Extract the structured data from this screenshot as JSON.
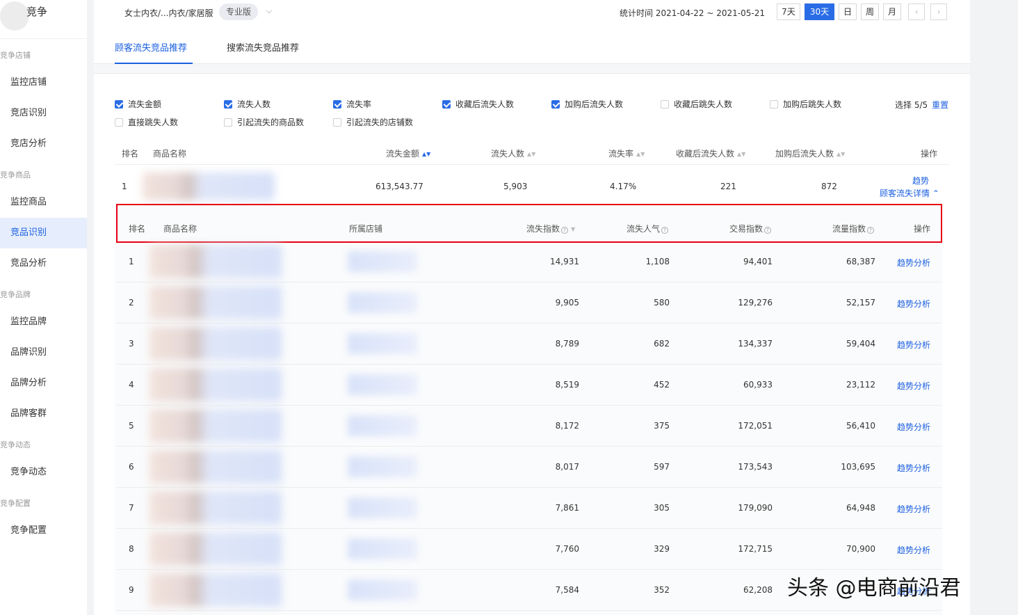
{
  "sidebar": {
    "brand": "竞争",
    "groups": [
      {
        "title": "竞争店铺",
        "items": [
          "监控店铺",
          "竞店识别",
          "竞店分析"
        ]
      },
      {
        "title": "竞争商品",
        "items": [
          "监控商品",
          "竞品识别",
          "竞品分析"
        ]
      },
      {
        "title": "竞争品牌",
        "items": [
          "监控品牌",
          "品牌识别",
          "品牌分析",
          "品牌客群"
        ]
      },
      {
        "title": "竞争动态",
        "items": [
          "竞争动态"
        ]
      },
      {
        "title": "竞争配置",
        "items": [
          "竞争配置"
        ]
      }
    ],
    "active_item": "竞品识别"
  },
  "topbar": {
    "breadcrumb": "女士内衣/...内衣/家居服",
    "tag": "专业版",
    "stat_time": "统计时间 2021-04-22 ~ 2021-05-21",
    "ranges": [
      "7天",
      "30天",
      "日",
      "周",
      "月"
    ],
    "active_range": "30天",
    "prev": "‹",
    "next": "›"
  },
  "tabs": [
    "顾客流失竞品推荐",
    "搜索流失竞品推荐"
  ],
  "filters": {
    "options": [
      {
        "label": "流失金额",
        "checked": true
      },
      {
        "label": "流失人数",
        "checked": true
      },
      {
        "label": "流失率",
        "checked": true
      },
      {
        "label": "收藏后流失人数",
        "checked": true
      },
      {
        "label": "加购后流失人数",
        "checked": true
      },
      {
        "label": "收藏后跳失人数",
        "checked": false
      },
      {
        "label": "加购后跳失人数",
        "checked": false
      },
      {
        "label": "直接跳失人数",
        "checked": false
      },
      {
        "label": "引起流失的商品数",
        "checked": false
      },
      {
        "label": "引起流失的店铺数",
        "checked": false
      }
    ],
    "select_count": "选择 5/5",
    "reset": "重置"
  },
  "main_table": {
    "headers": [
      "排名",
      "商品名称",
      "流失金额",
      "流失人数",
      "流失率",
      "收藏后流失人数",
      "加购后流失人数",
      "操作"
    ],
    "row": {
      "rank": "1",
      "amount": "613,543.77",
      "people": "5,903",
      "rate": "4.17%",
      "fav_lost": "221",
      "cart_lost": "872",
      "action_trend": "趋势",
      "action_detail": "顾客流失详情"
    }
  },
  "sub_table": {
    "headers": [
      "排名",
      "商品名称",
      "所属店铺",
      "流失指数",
      "流失人气",
      "交易指数",
      "流量指数",
      "操作"
    ],
    "action_label": "趋势分析",
    "rows": [
      {
        "rank": "1",
        "loss_index": "14,931",
        "loss_pop": "1,108",
        "trade": "94,401",
        "traffic": "68,387"
      },
      {
        "rank": "2",
        "loss_index": "9,905",
        "loss_pop": "580",
        "trade": "129,276",
        "traffic": "52,157"
      },
      {
        "rank": "3",
        "loss_index": "8,789",
        "loss_pop": "682",
        "trade": "134,337",
        "traffic": "59,404"
      },
      {
        "rank": "4",
        "loss_index": "8,519",
        "loss_pop": "452",
        "trade": "60,933",
        "traffic": "23,112"
      },
      {
        "rank": "5",
        "loss_index": "8,172",
        "loss_pop": "375",
        "trade": "172,051",
        "traffic": "56,410"
      },
      {
        "rank": "6",
        "loss_index": "8,017",
        "loss_pop": "597",
        "trade": "173,543",
        "traffic": "103,695"
      },
      {
        "rank": "7",
        "loss_index": "7,861",
        "loss_pop": "305",
        "trade": "179,090",
        "traffic": "64,948"
      },
      {
        "rank": "8",
        "loss_index": "7,760",
        "loss_pop": "329",
        "trade": "172,715",
        "traffic": "70,900"
      },
      {
        "rank": "9",
        "loss_index": "7,584",
        "loss_pop": "352",
        "trade": "62,208",
        "traffic": ""
      }
    ]
  },
  "watermark": "头条 @电商前沿君",
  "colors": {
    "accent": "#2a6ce6",
    "link": "#1b5fe0",
    "highlight_border": "#e60012"
  }
}
